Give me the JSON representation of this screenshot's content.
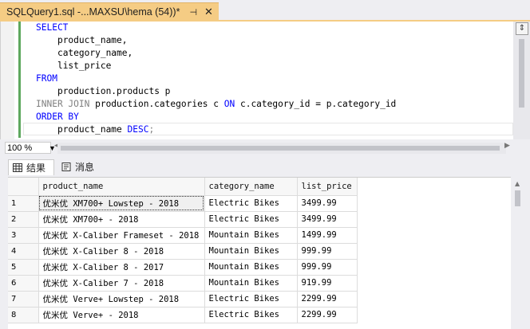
{
  "tab": {
    "title": "SQLQuery1.sql -...MAXSU\\hema (54))*",
    "pin_glyph": "⊣",
    "close_glyph": "✕"
  },
  "editor": {
    "lines": [
      {
        "kw": "SELECT",
        "rest": ""
      },
      {
        "indent": "    ",
        "text": "product_name,"
      },
      {
        "indent": "    ",
        "text": "category_name,"
      },
      {
        "indent": "    ",
        "text": "list_price"
      },
      {
        "kw": "FROM",
        "rest": ""
      },
      {
        "indent": "    ",
        "text": "production.products p"
      },
      {
        "join": "INNER JOIN",
        "mid": " production.categories c ",
        "on": "ON",
        "end": " c.category_id = p.category_id"
      },
      {
        "kw": "ORDER BY",
        "rest": ""
      },
      {
        "indent": "    ",
        "text": "product_name ",
        "kw2": "DESC",
        ";": ";"
      }
    ]
  },
  "zoom": {
    "value": "100 %"
  },
  "results_tabs": {
    "results": "结果",
    "messages": "消息"
  },
  "grid": {
    "columns": [
      "product_name",
      "category_name",
      "list_price"
    ],
    "rows": [
      {
        "n": "1",
        "product_name": "优米优 XM700+ Lowstep - 2018",
        "category_name": "Electric Bikes",
        "list_price": "3499.99"
      },
      {
        "n": "2",
        "product_name": "优米优 XM700+ - 2018",
        "category_name": "Electric Bikes",
        "list_price": "3499.99"
      },
      {
        "n": "3",
        "product_name": "优米优 X-Caliber Frameset - 2018",
        "category_name": "Mountain Bikes",
        "list_price": "1499.99"
      },
      {
        "n": "4",
        "product_name": "优米优 X-Caliber 8 - 2018",
        "category_name": "Mountain Bikes",
        "list_price": "999.99"
      },
      {
        "n": "5",
        "product_name": "优米优 X-Caliber 8 - 2017",
        "category_name": "Mountain Bikes",
        "list_price": "999.99"
      },
      {
        "n": "6",
        "product_name": "优米优 X-Caliber 7 - 2018",
        "category_name": "Mountain Bikes",
        "list_price": "919.99"
      },
      {
        "n": "7",
        "product_name": "优米优 Verve+ Lowstep - 2018",
        "category_name": "Electric Bikes",
        "list_price": "2299.99"
      },
      {
        "n": "8",
        "product_name": "优米优 Verve+ - 2018",
        "category_name": "Electric Bikes",
        "list_price": "2299.99"
      }
    ]
  },
  "colors": {
    "tab_active": "#f5cc84",
    "keyword": "#0000ff",
    "gray_keyword": "#808080",
    "change_bar": "#5ea85e"
  }
}
